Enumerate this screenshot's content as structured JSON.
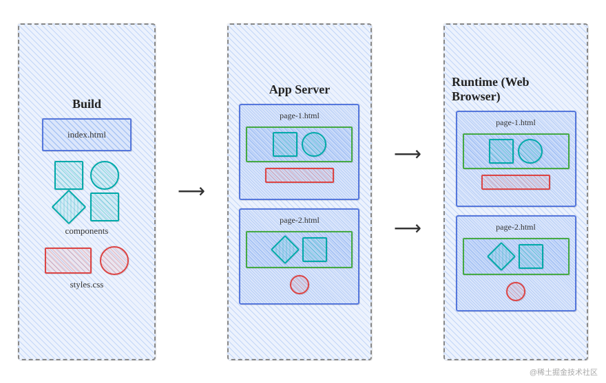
{
  "diagram": {
    "sections": {
      "build": {
        "title": "Build",
        "index_label": "index.html",
        "components_label": "components",
        "styles_label": "styles.css"
      },
      "server": {
        "title": "App Server",
        "page1_title": "page-1.html",
        "page2_title": "page-2.html"
      },
      "runtime": {
        "title": "Runtime (Web Browser)",
        "page1_title": "page-1.html",
        "page2_title": "page-2.html"
      }
    },
    "watermark": "@稀土掘金技术社区",
    "arrows": [
      "→",
      "→",
      "→"
    ]
  }
}
